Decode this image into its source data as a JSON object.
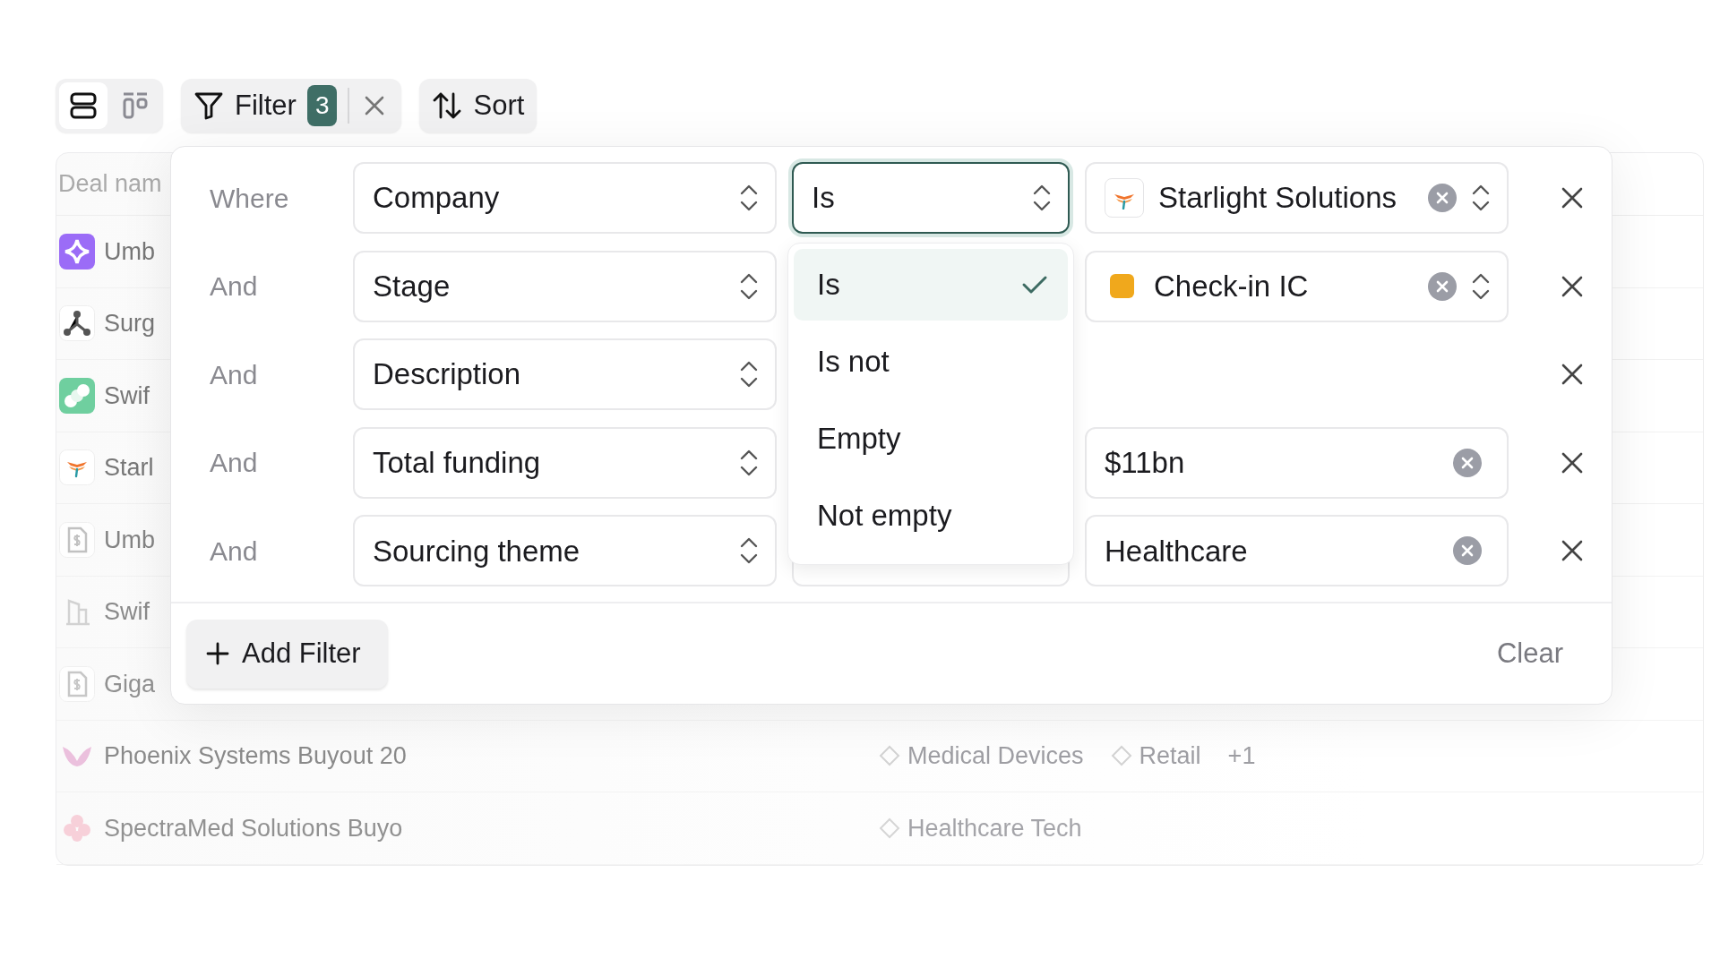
{
  "toolbar": {
    "view_modes": [
      {
        "kind": "rows",
        "selected": true
      },
      {
        "kind": "board",
        "selected": false
      }
    ],
    "filter_button": {
      "label": "Filter",
      "count": "3"
    },
    "sort_button": {
      "label": "Sort"
    }
  },
  "table": {
    "header": "Deal nam",
    "rows": [
      {
        "kind": "sparkle",
        "name": "Umb"
      },
      {
        "kind": "nodes",
        "name": "Surg"
      },
      {
        "kind": "pill",
        "name": "Swif"
      },
      {
        "kind": "wings",
        "name": "Starl"
      },
      {
        "kind": "invoice",
        "name": "Umb"
      },
      {
        "kind": "building",
        "name": "Swif"
      },
      {
        "kind": "invoice",
        "name": "Giga"
      },
      {
        "kind": "bird",
        "name": "Phoenix Systems Buyout 20",
        "tags": [
          "Medical Devices",
          "Retail"
        ],
        "more": "+1"
      },
      {
        "kind": "flower",
        "name": "SpectraMed Solutions Buyo",
        "tags": [
          "Healthcare Tech"
        ]
      }
    ]
  },
  "filter_panel": {
    "rows": [
      {
        "conjunction": "Where",
        "field": "Company",
        "operator": "Is",
        "focused": true,
        "value": {
          "kind": "company",
          "text": "Starlight Solutions"
        }
      },
      {
        "conjunction": "And",
        "field": "Stage",
        "value": {
          "kind": "stage",
          "text": "Check-in IC",
          "color": "#f0a81c"
        }
      },
      {
        "conjunction": "And",
        "field": "Description"
      },
      {
        "conjunction": "And",
        "field": "Total funding",
        "value": {
          "kind": "text",
          "text": "$11bn"
        }
      },
      {
        "conjunction": "And",
        "field": "Sourcing theme",
        "value": {
          "kind": "text",
          "text": "Healthcare"
        }
      }
    ],
    "operator_menu": {
      "options": [
        {
          "label": "Is",
          "selected": true
        },
        {
          "label": "Is not",
          "selected": false
        },
        {
          "label": "Empty",
          "selected": false
        },
        {
          "label": "Not empty",
          "selected": false
        }
      ]
    },
    "add_filter": "Add Filter",
    "clear": "Clear"
  }
}
